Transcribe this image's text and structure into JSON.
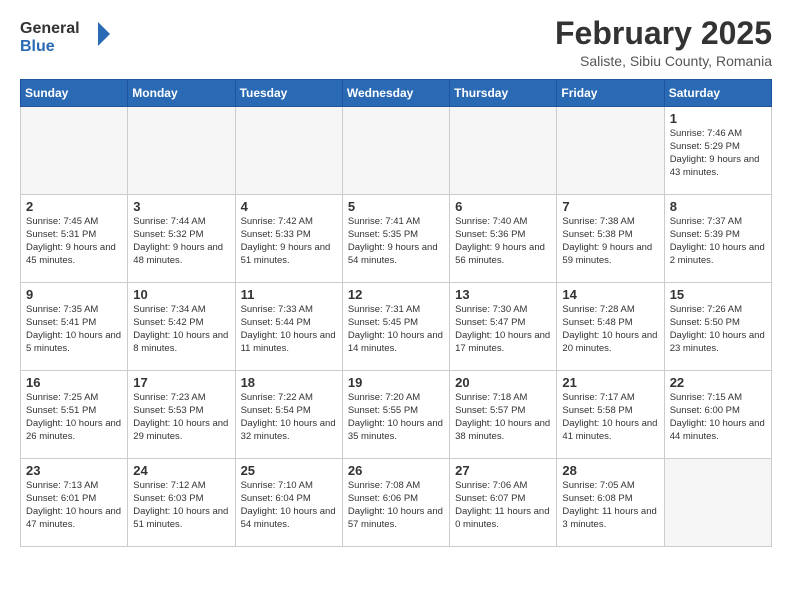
{
  "header": {
    "logo_general": "General",
    "logo_blue": "Blue",
    "month_title": "February 2025",
    "location": "Saliste, Sibiu County, Romania"
  },
  "weekdays": [
    "Sunday",
    "Monday",
    "Tuesday",
    "Wednesday",
    "Thursday",
    "Friday",
    "Saturday"
  ],
  "weeks": [
    [
      {
        "day": "",
        "info": ""
      },
      {
        "day": "",
        "info": ""
      },
      {
        "day": "",
        "info": ""
      },
      {
        "day": "",
        "info": ""
      },
      {
        "day": "",
        "info": ""
      },
      {
        "day": "",
        "info": ""
      },
      {
        "day": "1",
        "info": "Sunrise: 7:46 AM\nSunset: 5:29 PM\nDaylight: 9 hours and 43 minutes."
      }
    ],
    [
      {
        "day": "2",
        "info": "Sunrise: 7:45 AM\nSunset: 5:31 PM\nDaylight: 9 hours and 45 minutes."
      },
      {
        "day": "3",
        "info": "Sunrise: 7:44 AM\nSunset: 5:32 PM\nDaylight: 9 hours and 48 minutes."
      },
      {
        "day": "4",
        "info": "Sunrise: 7:42 AM\nSunset: 5:33 PM\nDaylight: 9 hours and 51 minutes."
      },
      {
        "day": "5",
        "info": "Sunrise: 7:41 AM\nSunset: 5:35 PM\nDaylight: 9 hours and 54 minutes."
      },
      {
        "day": "6",
        "info": "Sunrise: 7:40 AM\nSunset: 5:36 PM\nDaylight: 9 hours and 56 minutes."
      },
      {
        "day": "7",
        "info": "Sunrise: 7:38 AM\nSunset: 5:38 PM\nDaylight: 9 hours and 59 minutes."
      },
      {
        "day": "8",
        "info": "Sunrise: 7:37 AM\nSunset: 5:39 PM\nDaylight: 10 hours and 2 minutes."
      }
    ],
    [
      {
        "day": "9",
        "info": "Sunrise: 7:35 AM\nSunset: 5:41 PM\nDaylight: 10 hours and 5 minutes."
      },
      {
        "day": "10",
        "info": "Sunrise: 7:34 AM\nSunset: 5:42 PM\nDaylight: 10 hours and 8 minutes."
      },
      {
        "day": "11",
        "info": "Sunrise: 7:33 AM\nSunset: 5:44 PM\nDaylight: 10 hours and 11 minutes."
      },
      {
        "day": "12",
        "info": "Sunrise: 7:31 AM\nSunset: 5:45 PM\nDaylight: 10 hours and 14 minutes."
      },
      {
        "day": "13",
        "info": "Sunrise: 7:30 AM\nSunset: 5:47 PM\nDaylight: 10 hours and 17 minutes."
      },
      {
        "day": "14",
        "info": "Sunrise: 7:28 AM\nSunset: 5:48 PM\nDaylight: 10 hours and 20 minutes."
      },
      {
        "day": "15",
        "info": "Sunrise: 7:26 AM\nSunset: 5:50 PM\nDaylight: 10 hours and 23 minutes."
      }
    ],
    [
      {
        "day": "16",
        "info": "Sunrise: 7:25 AM\nSunset: 5:51 PM\nDaylight: 10 hours and 26 minutes."
      },
      {
        "day": "17",
        "info": "Sunrise: 7:23 AM\nSunset: 5:53 PM\nDaylight: 10 hours and 29 minutes."
      },
      {
        "day": "18",
        "info": "Sunrise: 7:22 AM\nSunset: 5:54 PM\nDaylight: 10 hours and 32 minutes."
      },
      {
        "day": "19",
        "info": "Sunrise: 7:20 AM\nSunset: 5:55 PM\nDaylight: 10 hours and 35 minutes."
      },
      {
        "day": "20",
        "info": "Sunrise: 7:18 AM\nSunset: 5:57 PM\nDaylight: 10 hours and 38 minutes."
      },
      {
        "day": "21",
        "info": "Sunrise: 7:17 AM\nSunset: 5:58 PM\nDaylight: 10 hours and 41 minutes."
      },
      {
        "day": "22",
        "info": "Sunrise: 7:15 AM\nSunset: 6:00 PM\nDaylight: 10 hours and 44 minutes."
      }
    ],
    [
      {
        "day": "23",
        "info": "Sunrise: 7:13 AM\nSunset: 6:01 PM\nDaylight: 10 hours and 47 minutes."
      },
      {
        "day": "24",
        "info": "Sunrise: 7:12 AM\nSunset: 6:03 PM\nDaylight: 10 hours and 51 minutes."
      },
      {
        "day": "25",
        "info": "Sunrise: 7:10 AM\nSunset: 6:04 PM\nDaylight: 10 hours and 54 minutes."
      },
      {
        "day": "26",
        "info": "Sunrise: 7:08 AM\nSunset: 6:06 PM\nDaylight: 10 hours and 57 minutes."
      },
      {
        "day": "27",
        "info": "Sunrise: 7:06 AM\nSunset: 6:07 PM\nDaylight: 11 hours and 0 minutes."
      },
      {
        "day": "28",
        "info": "Sunrise: 7:05 AM\nSunset: 6:08 PM\nDaylight: 11 hours and 3 minutes."
      },
      {
        "day": "",
        "info": ""
      }
    ]
  ]
}
